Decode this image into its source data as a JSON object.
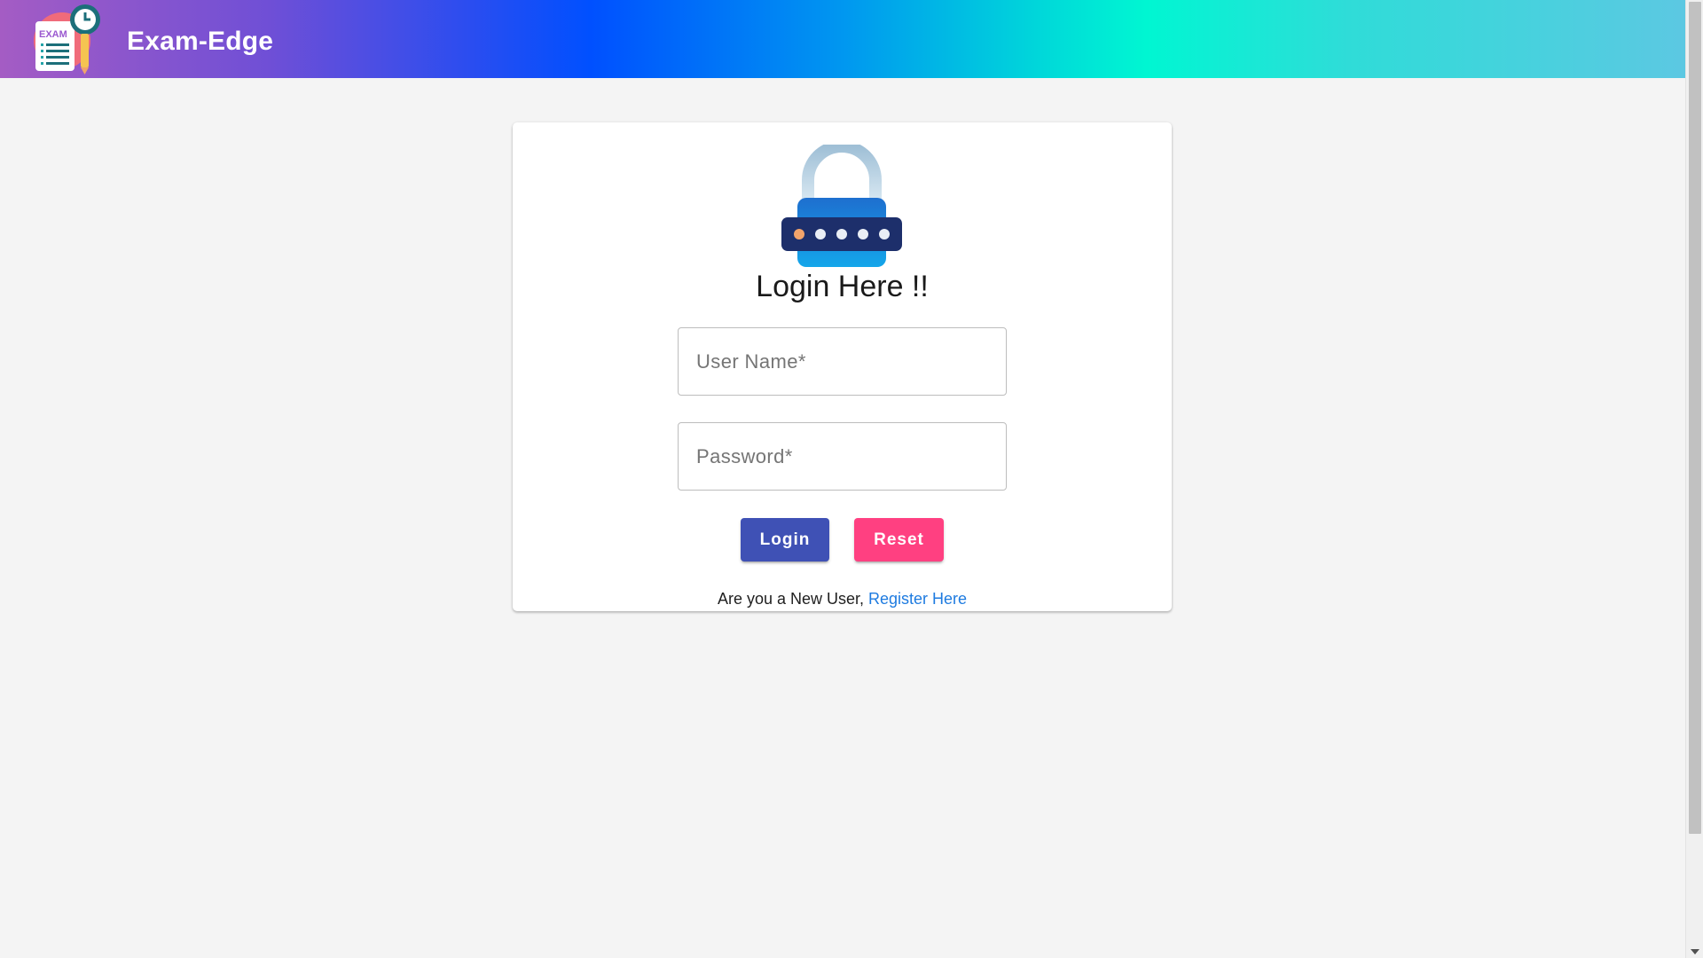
{
  "header": {
    "brand_title": "Exam-Edge",
    "logo_icon": "exam-logo-icon",
    "logo_text": "EXAM"
  },
  "login": {
    "lock_icon": "padlock-icon",
    "title": "Login Here !!",
    "username_placeholder": "User Name*",
    "password_placeholder": "Password*",
    "username_value": "",
    "password_value": "",
    "login_label": "Login",
    "reset_label": "Reset",
    "register_prompt": "Are you a New User, ",
    "register_link": "Register Here"
  },
  "colors": {
    "login_button": "#3f51b5",
    "reset_button": "#ff4081",
    "link": "#1e7be0"
  }
}
